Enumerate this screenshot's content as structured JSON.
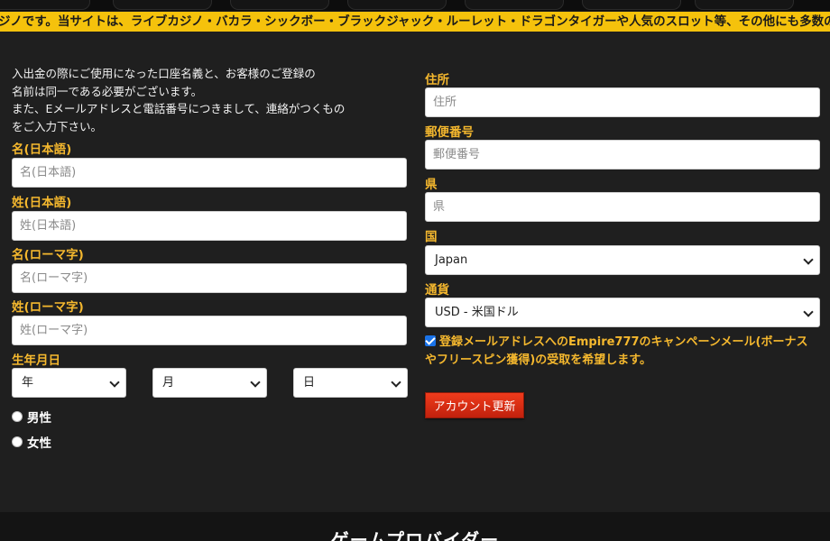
{
  "ticker": {
    "text": "ジノです。当サイトは、ライブカジノ・バカラ・シックボー・ブラックジャック・ルーレット・ドラゴンタイガーや人気のスロット等、その他にも多数のゲームをご"
  },
  "intro": {
    "lines": [
      "入出金の際にご使用になった口座名義と、お客様のご登録の",
      "名前は同一である必要がございます。",
      "また、Eメールアドレスと電話番号につきまして、連絡がつくもの",
      "をご入力下さい。"
    ]
  },
  "form": {
    "first_name_jp": {
      "label": "名(日本語)",
      "placeholder": "名(日本語)"
    },
    "last_name_jp": {
      "label": "姓(日本語)",
      "placeholder": "姓(日本語)"
    },
    "first_name_roman": {
      "label": "名(ローマ字)",
      "placeholder": "名(ローマ字)"
    },
    "last_name_roman": {
      "label": "姓(ローマ字)",
      "placeholder": "姓(ローマ字)"
    },
    "birthdate": {
      "label": "生年月日",
      "year": "年",
      "month": "月",
      "day": "日"
    },
    "gender": {
      "male": "男性",
      "female": "女性"
    },
    "address": {
      "label": "住所",
      "placeholder": "住所"
    },
    "postal": {
      "label": "郵便番号",
      "placeholder": "郵便番号"
    },
    "prefecture": {
      "label": "県",
      "placeholder": "県"
    },
    "country": {
      "label": "国",
      "value": "Japan"
    },
    "currency": {
      "label": "通貨",
      "value": "USD - 米国ドル"
    },
    "newsletter": {
      "line1": "登録メールアドレスへのEmpire777のキャンペーンメール(ボーナス",
      "line2": "やフリースピン獲得)の受取を希望します。"
    },
    "submit_label": "アカウント更新"
  },
  "footer": {
    "heading": "ゲームプロバイダー"
  },
  "colors": {
    "accent": "#f5b82e",
    "ticker_bg": "#f5c20c",
    "button": "#d92b13"
  }
}
